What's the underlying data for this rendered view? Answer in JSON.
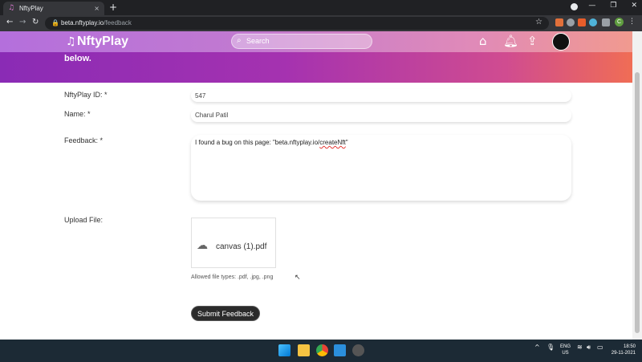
{
  "browser": {
    "tab_title": "NftyPlay",
    "url_host": "beta.nftyplay.io",
    "url_path": "/feedback",
    "tab_close": "×",
    "new_tab": "+"
  },
  "site": {
    "logo": "NftyPlay",
    "search_placeholder": "Search",
    "header_text": "below."
  },
  "form": {
    "id_label": "NftyPlay ID: *",
    "id_value": "547",
    "name_label": "Name: *",
    "name_value": "Charul Patil",
    "feedback_label": "Feedback: *",
    "feedback_value_prefix": "I found a bug on this page: \"beta.nftyplay.io/",
    "feedback_value_link": "createNft",
    "feedback_value_suffix": "\"",
    "upload_label": "Upload File:",
    "file_name": "canvas (1).pdf",
    "allowed_types": "Allowed file types: .pdf, .jpg, .png",
    "submit_label": "Submit Feedback"
  },
  "taskbar": {
    "lang_top": "ENG",
    "lang_bottom": "US",
    "time": "18:50",
    "date": "29-11-2021"
  },
  "colors": {
    "header_start": "#8a2bb5",
    "header_end": "#f06d55",
    "submit_bg": "#2b2b2b"
  }
}
